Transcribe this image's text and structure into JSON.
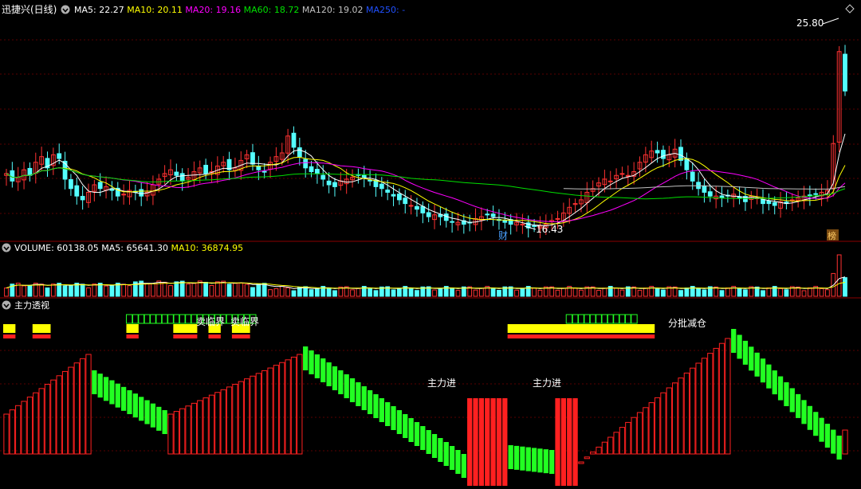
{
  "colors": {
    "background": "#000000",
    "separator": "#8b0000",
    "grid": "#5a0000",
    "up": "#ff3232",
    "down": "#54ffff",
    "ma5": "#ffffff",
    "ma10": "#ffff00",
    "ma20": "#ff00ff",
    "ma60": "#00e000",
    "ma120": "#c0c0c0",
    "ma250": "#0040ff",
    "hist_up": "#ff2020",
    "hist_down": "#22ff22",
    "marker_yellow": "#ffff00",
    "marker_red": "#ff2020",
    "box_green": "#22ff22",
    "text_white": "#ffffff"
  },
  "price_panel": {
    "title": "迅捷兴(日线)",
    "indicators": [
      {
        "label": "MA5: 22.27",
        "color": "#ffffff"
      },
      {
        "label": "MA10: 20.11",
        "color": "#ffff00"
      },
      {
        "label": "MA20: 19.16",
        "color": "#ff00ff"
      },
      {
        "label": "MA60: 18.72",
        "color": "#00e000"
      },
      {
        "label": "MA120: 19.02",
        "color": "#c0c0c0"
      },
      {
        "label": "MA250: -",
        "color": "#2050ff"
      }
    ],
    "high_label": "25.80",
    "low_label": "16.43",
    "marker_cai": "财",
    "marker_bang": "榜"
  },
  "volume_panel": {
    "indicators": [
      {
        "label": "VOLUME: 60138.05",
        "color": "#ffffff"
      },
      {
        "label": "MA5: 65641.30",
        "color": "#ffffff"
      },
      {
        "label": "MA10: 36874.95",
        "color": "#ffff00"
      }
    ]
  },
  "indicator_panel": {
    "title": "主力透视",
    "annotations": [
      {
        "text": "卖临界",
        "anchor": "sell-1"
      },
      {
        "text": "卖临界",
        "anchor": "sell-2"
      },
      {
        "text": "主力进",
        "anchor": "buy-1"
      },
      {
        "text": "主力进",
        "anchor": "buy-2"
      },
      {
        "text": "分批减仓",
        "anchor": "reduce"
      }
    ]
  },
  "chart_data": {
    "type": "candlestick",
    "ylim": [
      15.2,
      27.0
    ],
    "closes": [
      18.6,
      18.2,
      18.4,
      18.8,
      18.5,
      19.2,
      19.5,
      18.9,
      19.6,
      19.4,
      18.3,
      17.8,
      17.4,
      17.2,
      17.6,
      18.0,
      17.8,
      17.9,
      17.7,
      17.4,
      17.5,
      17.7,
      17.6,
      17.4,
      17.6,
      18.0,
      18.3,
      18.6,
      18.8,
      18.5,
      18.2,
      18.4,
      18.7,
      18.9,
      18.6,
      18.7,
      19.0,
      19.2,
      18.8,
      18.9,
      19.3,
      19.6,
      19.1,
      18.8,
      18.7,
      19.2,
      19.5,
      19.7,
      20.6,
      20.0,
      19.5,
      18.9,
      18.7,
      18.6,
      18.3,
      18.0,
      17.9,
      18.2,
      18.3,
      18.4,
      18.5,
      18.4,
      18.2,
      17.9,
      17.8,
      17.6,
      17.4,
      17.2,
      17.0,
      16.9,
      16.7,
      16.5,
      16.3,
      16.4,
      16.3,
      16.1,
      16.0,
      16.0,
      15.9,
      16.0,
      16.2,
      16.3,
      16.4,
      16.3,
      16.1,
      16.0,
      15.9,
      16.0,
      15.9,
      15.7,
      15.8,
      15.8,
      15.9,
      16.1,
      16.2,
      16.5,
      16.8,
      17.0,
      17.2,
      17.6,
      17.8,
      18.1,
      18.3,
      18.2,
      18.5,
      18.6,
      18.5,
      18.7,
      19.2,
      19.6,
      19.8,
      19.7,
      19.4,
      19.6,
      19.9,
      19.3,
      18.8,
      18.2,
      17.8,
      17.6,
      17.4,
      17.4,
      17.3,
      17.4,
      17.5,
      17.3,
      17.1,
      17.4,
      17.3,
      17.0,
      17.0,
      16.9,
      17.1,
      17.0,
      17.2,
      17.3,
      17.4,
      17.4,
      17.5,
      17.6,
      17.7,
      20.2,
      25.1,
      23.0
    ]
  }
}
